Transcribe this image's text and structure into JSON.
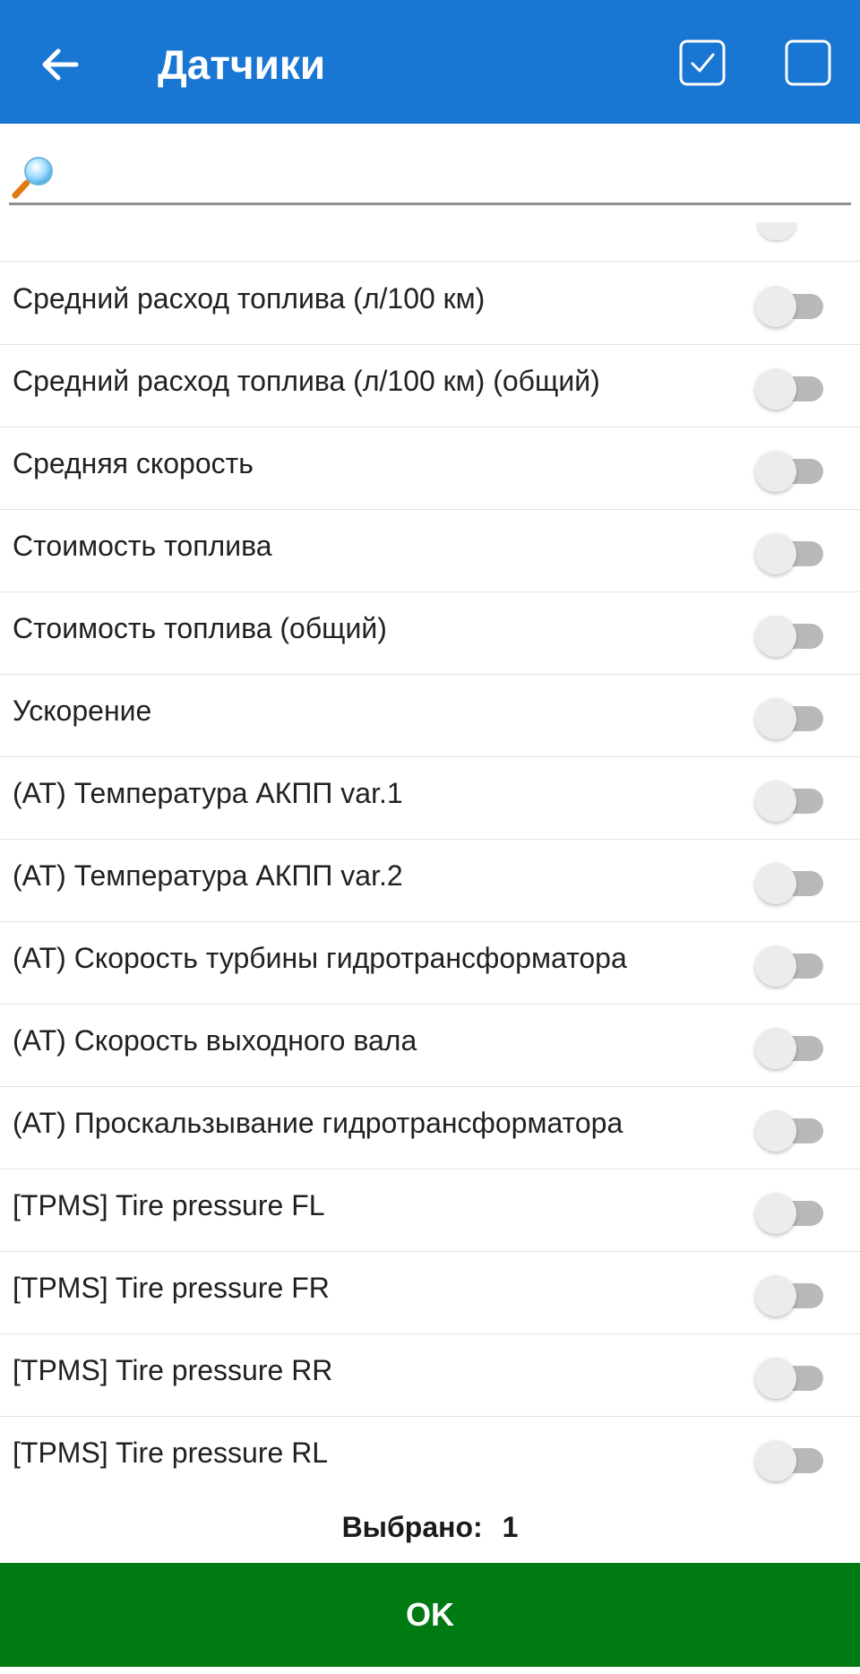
{
  "header": {
    "title": "Датчики",
    "back_icon": "arrow-left-icon",
    "select_all_icon": "checkbox-checked-icon",
    "deselect_all_icon": "checkbox-empty-icon",
    "bar_color": "#1976d2"
  },
  "search": {
    "value": "",
    "placeholder": "",
    "icon": "magnifier-icon"
  },
  "sensors": [
    {
      "label": "Средний расход топлива (л/100 км)",
      "enabled": false
    },
    {
      "label": "Средний расход топлива (л/100 км) (общий)",
      "enabled": false
    },
    {
      "label": "Средняя скорость",
      "enabled": false
    },
    {
      "label": "Стоимость топлива",
      "enabled": false
    },
    {
      "label": "Стоимость топлива (общий)",
      "enabled": false
    },
    {
      "label": "Ускорение",
      "enabled": false
    },
    {
      "label": "(AT) Температура АКПП var.1",
      "enabled": false
    },
    {
      "label": "(AT) Температура АКПП var.2",
      "enabled": false
    },
    {
      "label": "(AT) Скорость турбины гидротрансформатора",
      "enabled": false
    },
    {
      "label": "(AT) Скорость выходного вала",
      "enabled": false
    },
    {
      "label": "(AT) Проскальзывание гидротрансформатора",
      "enabled": false
    },
    {
      "label": "[TPMS] Tire pressure FL",
      "enabled": false
    },
    {
      "label": "[TPMS] Tire pressure FR",
      "enabled": false
    },
    {
      "label": "[TPMS] Tire pressure RR",
      "enabled": false
    },
    {
      "label": "[TPMS] Tire pressure RL",
      "enabled": false
    }
  ],
  "footer": {
    "selected_label": "Выбрано:",
    "selected_count": "1",
    "ok_label": "OK",
    "ok_color": "#007a13"
  }
}
